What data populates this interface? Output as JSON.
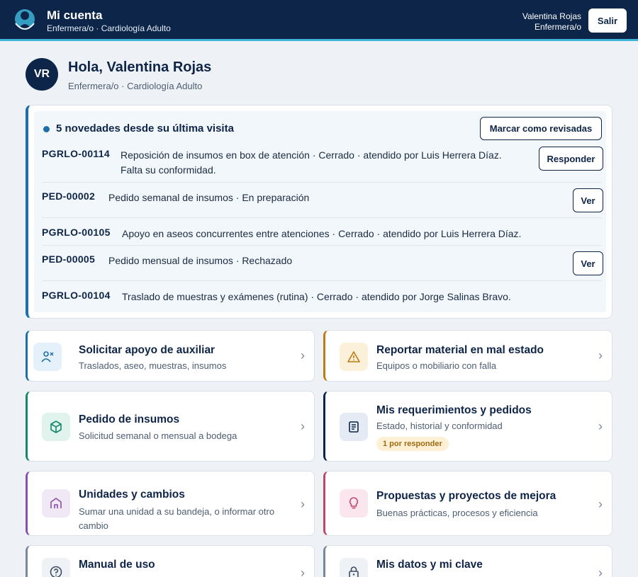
{
  "header": {
    "app_title": "Mi cuenta",
    "app_subtitle": "Enfermera/o · Cardiología Adulto",
    "user_name": "Valentina Rojas",
    "user_role": "Enfermera/o",
    "logout_label": "Salir"
  },
  "profile": {
    "initials": "VR",
    "greeting": "Hola, Valentina Rojas",
    "subtitle": "Enfermera/o · Cardiología Adulto"
  },
  "news": {
    "title": "5 novedades desde su última visita",
    "mark_label": "Marcar como revisadas",
    "items": [
      {
        "code": "PGRLO-00114",
        "text": "Reposición de insumos en box de atención · Cerrado · atendido por Luis Herrera Díaz.",
        "text2": "Falta su conformidad.",
        "action": "Responder"
      },
      {
        "code": "PED-00002",
        "text": "Pedido semanal de insumos · En preparación",
        "action": "Ver"
      },
      {
        "code": "PGRLO-00105",
        "text": "Apoyo en aseos concurrentes entre atenciones · Cerrado · atendido por Luis Herrera Díaz."
      },
      {
        "code": "PED-00005",
        "text": "Pedido mensual de insumos · Rechazado",
        "action": "Ver"
      },
      {
        "code": "PGRLO-00104",
        "text": "Traslado de muestras y exámenes (rutina) · Cerrado · atendido por Jorge Salinas Bravo."
      }
    ]
  },
  "cards": [
    {
      "title": "Solicitar apoyo de auxiliar",
      "subtitle": "Traslados, aseo, muestras, insumos",
      "icon": "person-assist-icon",
      "accent": "#1c6fa8"
    },
    {
      "title": "Reportar material en mal estado",
      "subtitle": "Equipos o mobiliario con falla",
      "icon": "warning-icon",
      "accent": "#c07a12"
    },
    {
      "title": "Pedido de insumos",
      "subtitle": "Solicitud semanal o mensual a bodega",
      "icon": "box-icon",
      "accent": "#16876a"
    },
    {
      "title": "Mis requerimientos y pedidos",
      "subtitle": "Estado, historial y conformidad",
      "badge": "1 por responder",
      "icon": "document-icon",
      "accent": "#0c2549"
    },
    {
      "title": "Unidades y cambios",
      "subtitle": "Sumar una unidad a su bandeja, o informar otro cambio",
      "icon": "building-icon",
      "accent": "#8a4fa8"
    },
    {
      "title": "Propuestas y proyectos de mejora",
      "subtitle": "Buenas prácticas, procesos y eficiencia",
      "icon": "lightbulb-icon",
      "accent": "#c2456e"
    },
    {
      "title": "Manual de uso",
      "subtitle": "",
      "icon": "help-icon",
      "accent": "#7a8799"
    },
    {
      "title": "Mis datos y mi clave",
      "subtitle": "",
      "icon": "lock-icon",
      "accent": "#7a8799"
    }
  ],
  "chevron": "›"
}
